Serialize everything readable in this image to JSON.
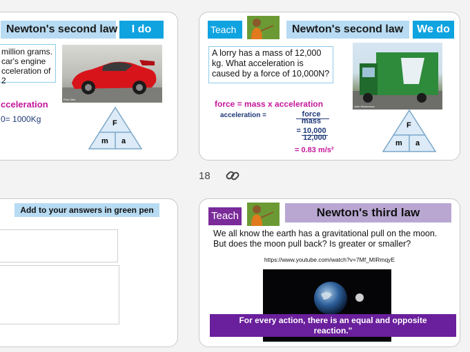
{
  "slide1": {
    "title": "Newton's second  law",
    "tag": "I do",
    "text_lines": [
      "million grams.",
      "car's engine",
      "cceleration of 2"
    ],
    "formula_label": "cceleration",
    "calc_line": "0= 1000Kg",
    "photo_caption": "Piotr Glitz",
    "triangle": {
      "top": "F",
      "left": "m",
      "right": "a"
    }
  },
  "slide2": {
    "teach_label": "Teach",
    "title": "Newton's second  law",
    "tag": "We do",
    "question": "A lorry has a mass of 12,000 kg. What acceleration is caused by a force of 10,000N?",
    "formula": "force  =  mass x acceleration",
    "acc_label": "acceleration  =",
    "frac1_num": "force",
    "frac1_den": "mass",
    "frac2_num": "= 10,000",
    "frac2_den": "12,000",
    "answer": "=  0.83 m/s²",
    "photo_caption": "Julie Westerman",
    "triangle": {
      "top": "F",
      "left": "m",
      "right": "a"
    }
  },
  "thumb": {
    "slide_number": "18",
    "link_icon": "link-icon"
  },
  "slide3": {
    "header": "Add to your answers in green pen"
  },
  "slide4": {
    "teach_label": "Teach",
    "title": "Newton's third law",
    "intro": "We all know the earth has a gravitational pull on the moon. But does the moon pull back? Is greater or smaller?",
    "url": "https://www.youtube.com/watch?v=7Mf_MIRmqyE",
    "quote": "For every action, there is an equal and opposite reaction.\""
  }
}
